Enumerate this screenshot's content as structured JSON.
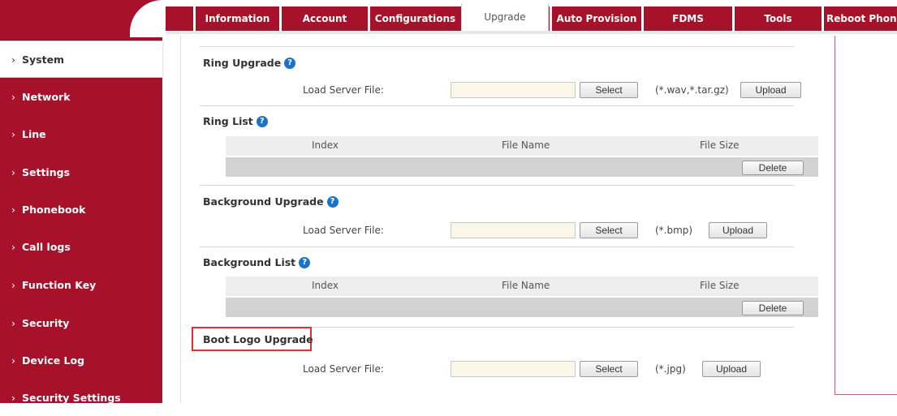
{
  "nav": {
    "tabs": [
      {
        "label": "Information"
      },
      {
        "label": "Account"
      },
      {
        "label": "Configurations"
      },
      {
        "label": "Upgrade"
      },
      {
        "label": "Auto Provision"
      },
      {
        "label": "FDMS"
      },
      {
        "label": "Tools"
      },
      {
        "label": "Reboot Phone"
      }
    ],
    "active_tab": "Upgrade"
  },
  "sidebar": {
    "items": [
      {
        "label": "System"
      },
      {
        "label": "Network"
      },
      {
        "label": "Line"
      },
      {
        "label": "Settings"
      },
      {
        "label": "Phonebook"
      },
      {
        "label": "Call logs"
      },
      {
        "label": "Function Key"
      },
      {
        "label": "Security"
      },
      {
        "label": "Device Log"
      },
      {
        "label": "Security Settings"
      }
    ],
    "active_item": "System",
    "chevron": "›"
  },
  "sections": {
    "ring_upgrade": {
      "title": "Ring Upgrade",
      "label": "Load Server File:",
      "input_value": "",
      "select_label": "Select",
      "extension": "(*.wav,*.tar.gz)",
      "upload_label": "Upload"
    },
    "ring_list": {
      "title": "Ring List",
      "columns": [
        "Index",
        "File Name",
        "File Size"
      ],
      "delete_label": "Delete"
    },
    "background_upgrade": {
      "title": "Background Upgrade",
      "label": "Load Server File:",
      "input_value": "",
      "select_label": "Select",
      "extension": "(*.bmp)",
      "upload_label": "Upload"
    },
    "background_list": {
      "title": "Background List",
      "columns": [
        "Index",
        "File Name",
        "File Size"
      ],
      "delete_label": "Delete"
    },
    "boot_logo_upgrade": {
      "title": "Boot Logo Upgrade",
      "label": "Load Server File:",
      "input_value": "",
      "select_label": "Select",
      "extension": "(*.jpg)",
      "upload_label": "Upload"
    }
  },
  "icons": {
    "help": "?"
  },
  "colors": {
    "brand": "#a8112a",
    "help_icon": "#1a73c8",
    "highlight": "#e03030"
  }
}
